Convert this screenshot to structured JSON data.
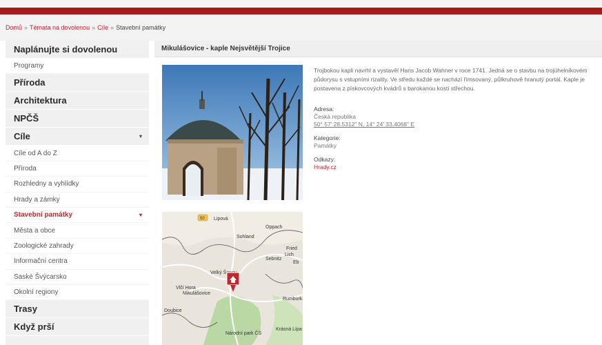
{
  "breadcrumb": {
    "items": [
      "Domů",
      "Témata na dovolenou",
      "Cíle"
    ],
    "separator": "»",
    "current": "Stavební památky"
  },
  "sidebar": {
    "items": [
      {
        "label": "Naplánujte si dovolenou",
        "type": "heading"
      },
      {
        "label": "Programy",
        "type": "sub"
      },
      {
        "label": "Příroda",
        "type": "heading"
      },
      {
        "label": "Architektura",
        "type": "heading"
      },
      {
        "label": "NPČŠ",
        "type": "heading"
      },
      {
        "label": "Cíle",
        "type": "heading",
        "arrow": "▾"
      },
      {
        "label": "Cíle od A do Z",
        "type": "sub"
      },
      {
        "label": "Příroda",
        "type": "sub"
      },
      {
        "label": "Rozhledny a vyhlídky",
        "type": "sub"
      },
      {
        "label": "Hrady a zámky",
        "type": "sub"
      },
      {
        "label": "Stavební památky",
        "type": "sub",
        "active": true,
        "arrow": "▾"
      },
      {
        "label": "Města a obce",
        "type": "sub"
      },
      {
        "label": "Zoologické zahrady",
        "type": "sub"
      },
      {
        "label": "Informační centra",
        "type": "sub"
      },
      {
        "label": "Saské Švýcarsko",
        "type": "sub"
      },
      {
        "label": "Okolní regiony",
        "type": "sub"
      },
      {
        "label": "Trasy",
        "type": "heading"
      },
      {
        "label": "Když prší",
        "type": "heading"
      }
    ]
  },
  "content": {
    "title": "Mikulášovice - kaple Nejsvětější Trojice",
    "description": "Trojbokou kapli navrhl a vystavěl Hans Jacob Wahner v roce 1741. Jedná se o stavbu na trojúhelníkovém půdorysu s vstupními rizality. Ve středu každé se nachází římsovaný, půlkruhově hranutý portál. Kaple je postavena z pískovcových kvádrů s barokanou kostí střechou.",
    "address_label": "Adresa:",
    "address_country": "Česká republika",
    "address_gps": "50° 57' 28.5312\" N, 14° 24' 33.4068\" E",
    "category_label": "Kategorie:",
    "category_value": "Památky",
    "links_label": "Odkazy:",
    "links_value": "Hrady.cz"
  },
  "map": {
    "labels": {
      "road": "50",
      "l1": "Lipová",
      "l2": "Sohland",
      "l3": "Velký Šenov",
      "l4": "Mikulášovice",
      "l5": "Vlčí Hora",
      "l6": "Rumburk",
      "l7": "Krásná Lípa",
      "l8": "Národní park ČŠ",
      "l9": "Doubice",
      "l10": "Fried",
      "l11": "Eb",
      "l12": "Sebnitz",
      "l13": "Oppach",
      "l14": "Lich"
    },
    "marker_color": "#c2262e"
  }
}
